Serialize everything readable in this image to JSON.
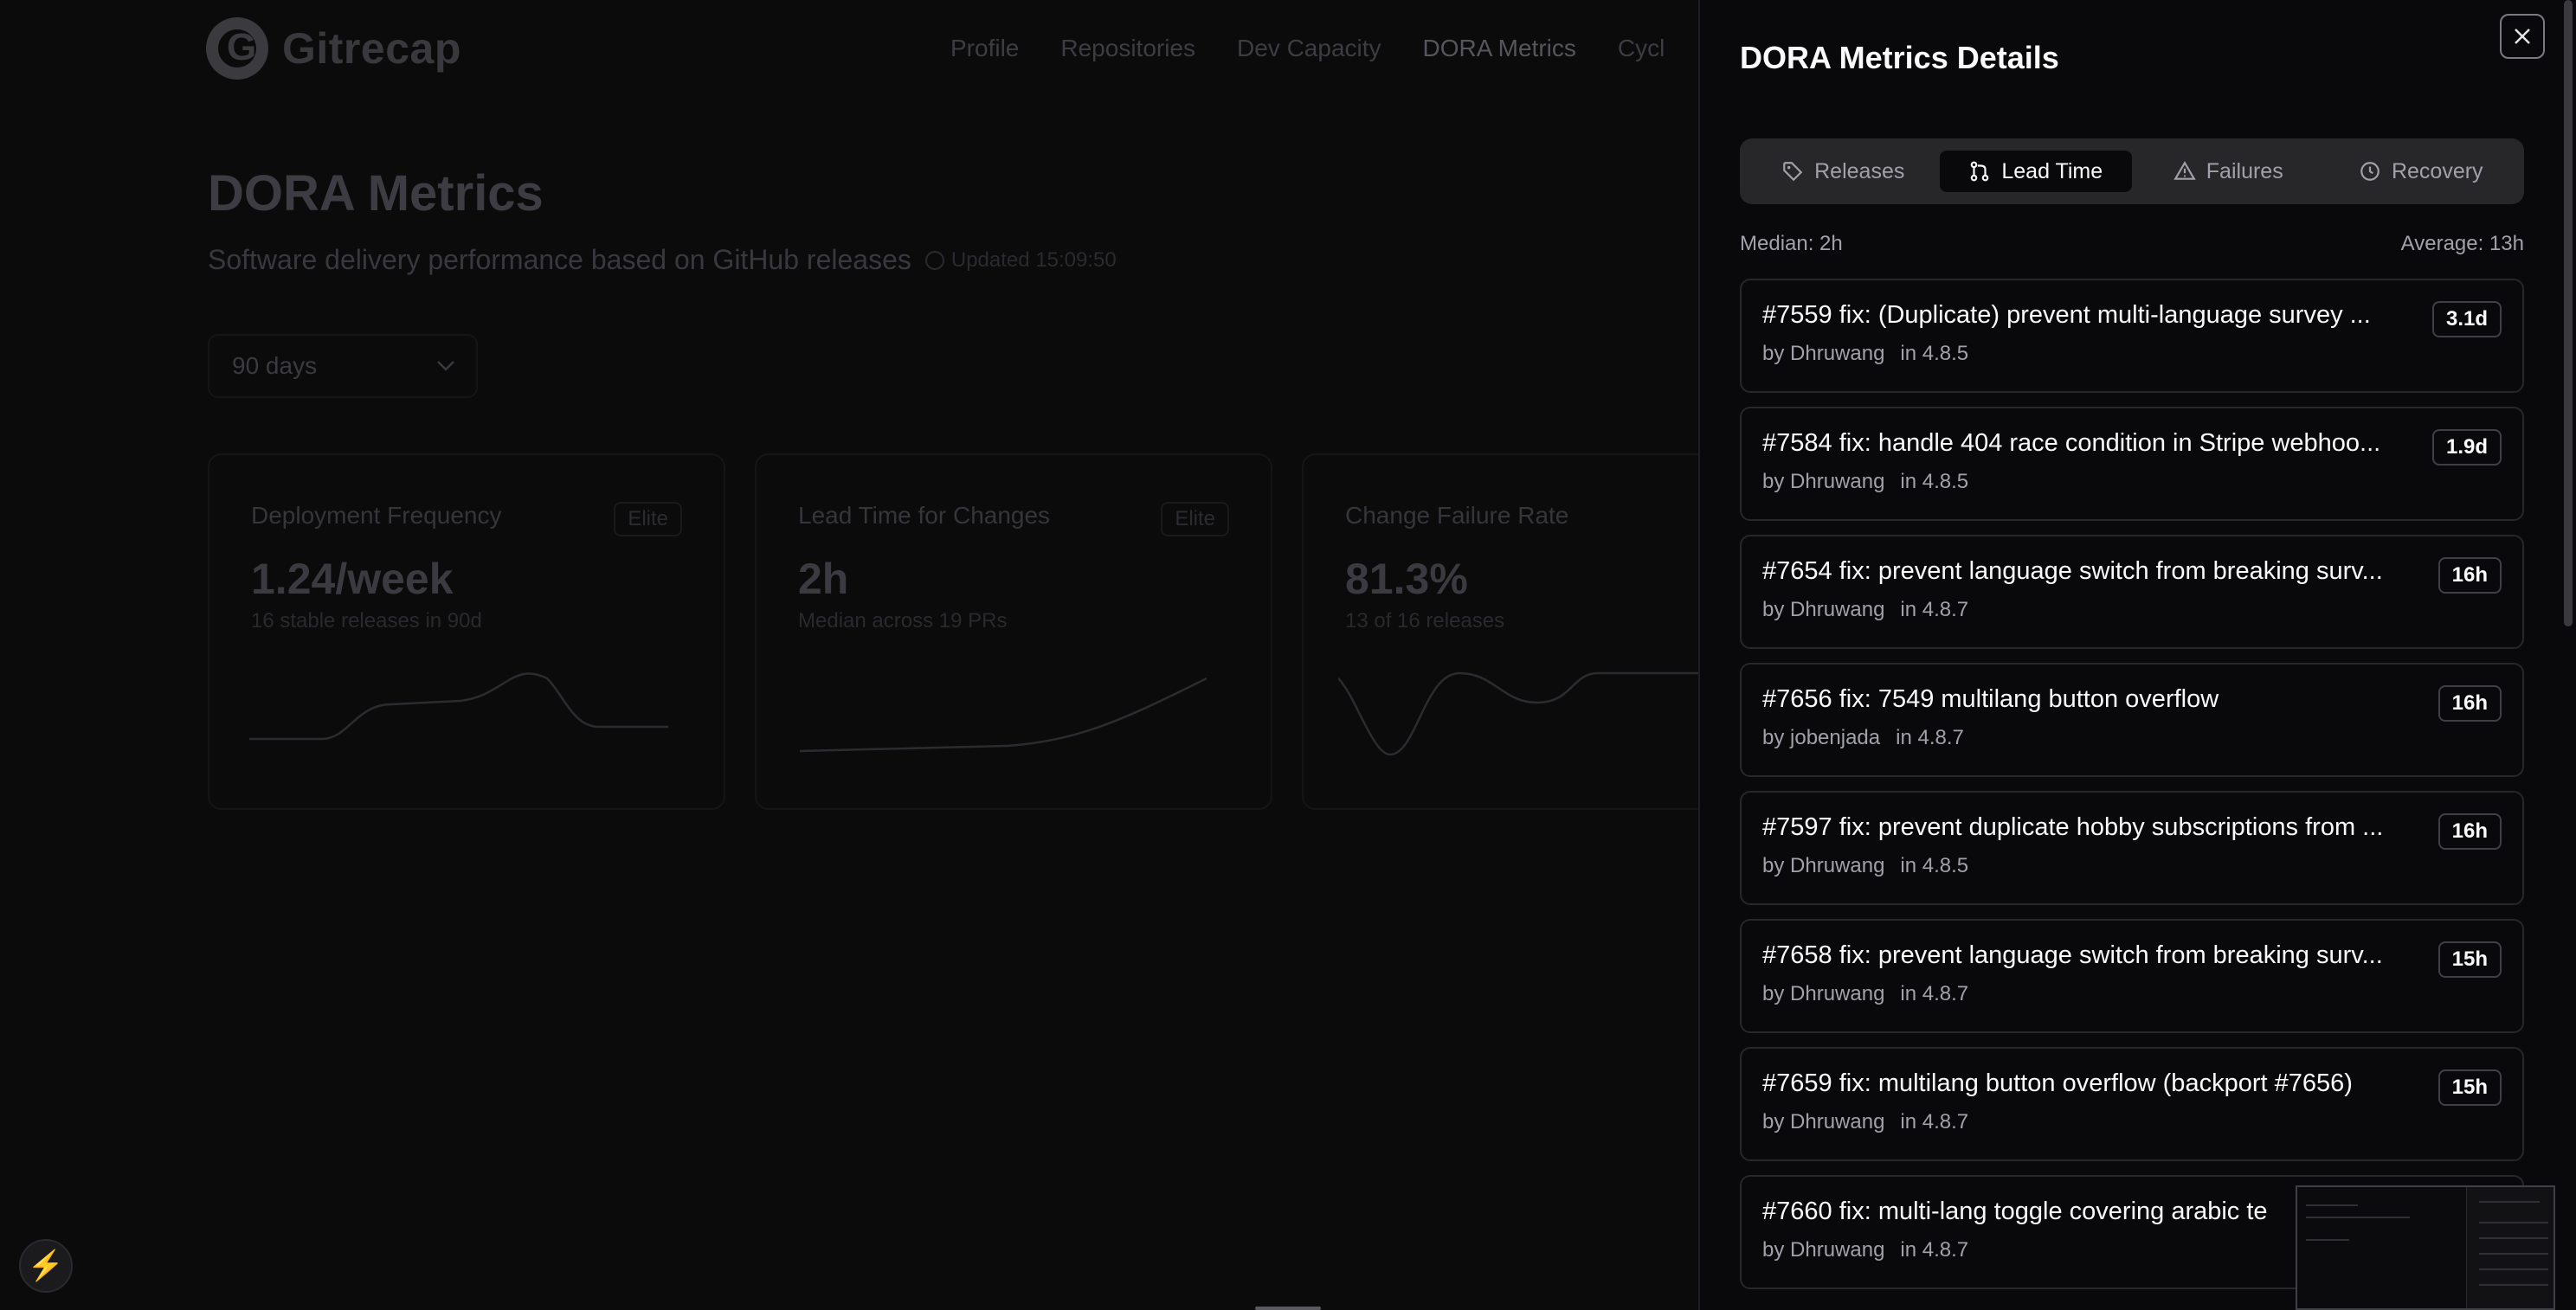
{
  "app": {
    "name": "Gitrecap"
  },
  "nav": [
    "Profile",
    "Repositories",
    "Dev Capacity",
    "DORA Metrics",
    "Cycl"
  ],
  "page": {
    "title": "DORA Metrics",
    "subtitle": "Software delivery performance based on GitHub releases",
    "updated": "Updated 15:09:50",
    "range": "90 days"
  },
  "cards": [
    {
      "title": "Deployment Frequency",
      "badge": "Elite",
      "value": "1.24/week",
      "note": "16 stable releases in 90d"
    },
    {
      "title": "Lead Time for Changes",
      "badge": "Elite",
      "value": "2h",
      "note": "Median across 19 PRs"
    },
    {
      "title": "Change Failure Rate",
      "badge": "",
      "value": "81.3%",
      "note": "13 of 16 releases"
    }
  ],
  "drawer": {
    "title": "DORA Metrics Details",
    "tabs": [
      {
        "label": "Releases",
        "icon": "tag-icon"
      },
      {
        "label": "Lead Time",
        "icon": "git-pull-request-icon"
      },
      {
        "label": "Failures",
        "icon": "warning-triangle-icon"
      },
      {
        "label": "Recovery",
        "icon": "clock-icon"
      }
    ],
    "active_tab": "Lead Time",
    "median": "Median: 2h",
    "average": "Average: 13h",
    "prs": [
      {
        "title": "#7559 fix: (Duplicate) prevent multi-language survey ...",
        "author": "by Dhruwang",
        "release": "in 4.8.5",
        "lead_time": "3.1d"
      },
      {
        "title": "#7584 fix: handle 404 race condition in Stripe webhoo...",
        "author": "by Dhruwang",
        "release": "in 4.8.5",
        "lead_time": "1.9d"
      },
      {
        "title": "#7654 fix: prevent language switch from breaking surv...",
        "author": "by Dhruwang",
        "release": "in 4.8.7",
        "lead_time": "16h"
      },
      {
        "title": "#7656 fix: 7549 multilang button overflow",
        "author": "by jobenjada",
        "release": "in 4.8.7",
        "lead_time": "16h"
      },
      {
        "title": "#7597 fix: prevent duplicate hobby subscriptions from ...",
        "author": "by Dhruwang",
        "release": "in 4.8.5",
        "lead_time": "16h"
      },
      {
        "title": "#7658 fix: prevent language switch from breaking surv...",
        "author": "by Dhruwang",
        "release": "in 4.8.7",
        "lead_time": "15h"
      },
      {
        "title": "#7659 fix: multilang button overflow (backport #7656)",
        "author": "by Dhruwang",
        "release": "in 4.8.7",
        "lead_time": "15h"
      },
      {
        "title": "#7660 fix: multi-lang toggle covering arabic te",
        "author": "by Dhruwang",
        "release": "in 4.8.7",
        "lead_time": ""
      }
    ]
  }
}
